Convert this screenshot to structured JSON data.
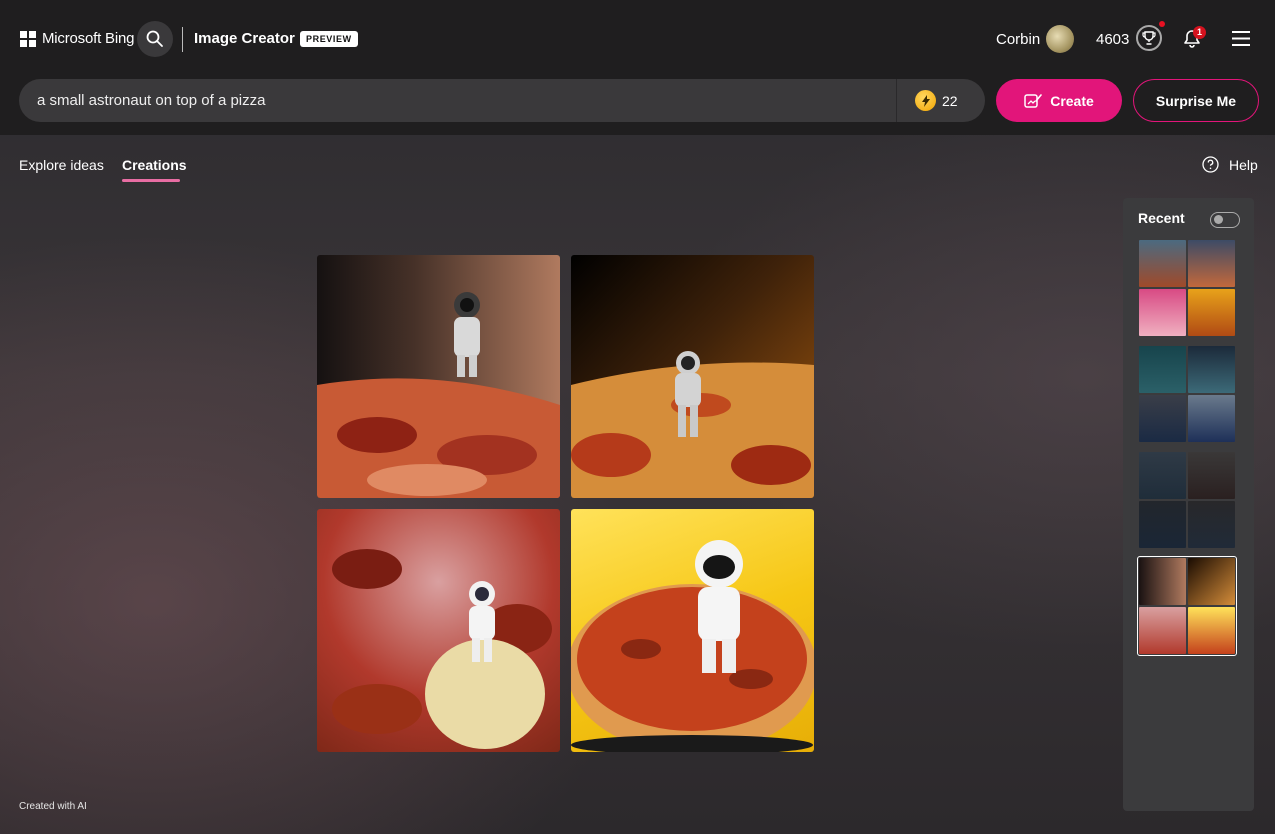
{
  "header": {
    "brand": "Microsoft Bing",
    "app_title": "Image Creator",
    "badge": "PREVIEW",
    "user": {
      "name": "Corbin"
    },
    "rewards_points": "4603",
    "notification_count": "1"
  },
  "prompt": {
    "value": "a small astronaut on top of a pizza",
    "boosts": "22"
  },
  "actions": {
    "create": "Create",
    "surprise": "Surprise Me"
  },
  "tabs": {
    "explore": "Explore ideas",
    "creations": "Creations",
    "help": "Help"
  },
  "recent": {
    "title": "Recent",
    "toggle_on": false
  },
  "footer": {
    "note": "Created with AI"
  },
  "colors": {
    "accent": "#e2157a",
    "tab_underline": "#e86da3",
    "header_bg": "#1f1e1f",
    "panel_bg": "#3b3b3d"
  }
}
